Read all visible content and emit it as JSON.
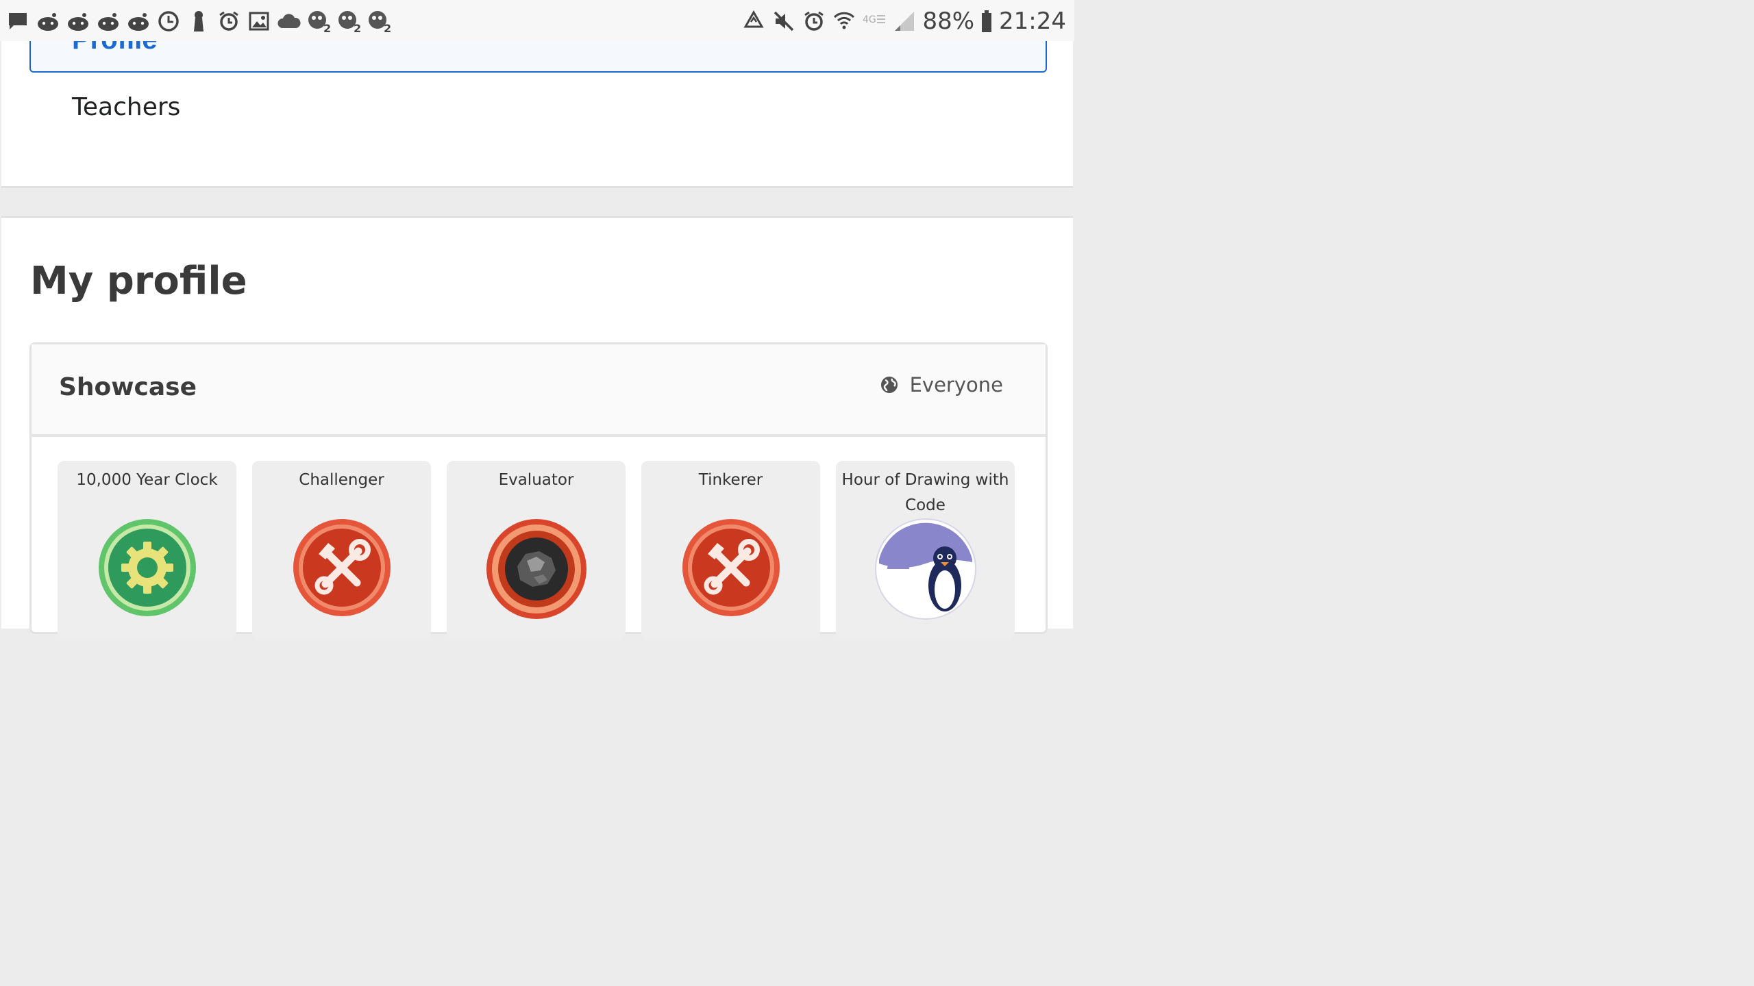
{
  "status_bar": {
    "battery": "88%",
    "time": "21:24",
    "notification_icons": [
      "message-icon",
      "reddit-icon",
      "reddit-icon",
      "reddit-icon",
      "reddit-icon",
      "clock-icon",
      "keyhole-icon",
      "alarm-icon",
      "image-icon",
      "cloud-icon",
      "game-icon",
      "game-icon",
      "game-icon"
    ],
    "system_icons": [
      "recycle-icon",
      "mute-icon",
      "alarm-icon",
      "wifi-icon",
      "network-4g-icon",
      "signal-icon",
      "battery-icon"
    ]
  },
  "nav": {
    "active_item": "Profile",
    "items": [
      {
        "label": "Teachers"
      }
    ]
  },
  "page": {
    "title": "My profile"
  },
  "showcase": {
    "title": "Showcase",
    "visibility": "Everyone",
    "visibility_icon": "globe-icon",
    "badges": [
      {
        "name": "10,000 Year Clock",
        "icon": "gear-badge-icon",
        "color": "#2e9a5b"
      },
      {
        "name": "Challenger",
        "icon": "tools-badge-icon",
        "color": "#c9381f"
      },
      {
        "name": "Evaluator",
        "icon": "rock-badge-icon",
        "color": "#d9452a"
      },
      {
        "name": "Tinkerer",
        "icon": "tools-badge-icon",
        "color": "#c9381f"
      },
      {
        "name": "Hour of Drawing with Code",
        "icon": "penguin-badge-icon",
        "color": "#8a86cc"
      }
    ]
  },
  "colors": {
    "accent": "#1a6ad1",
    "background": "#ececec"
  }
}
